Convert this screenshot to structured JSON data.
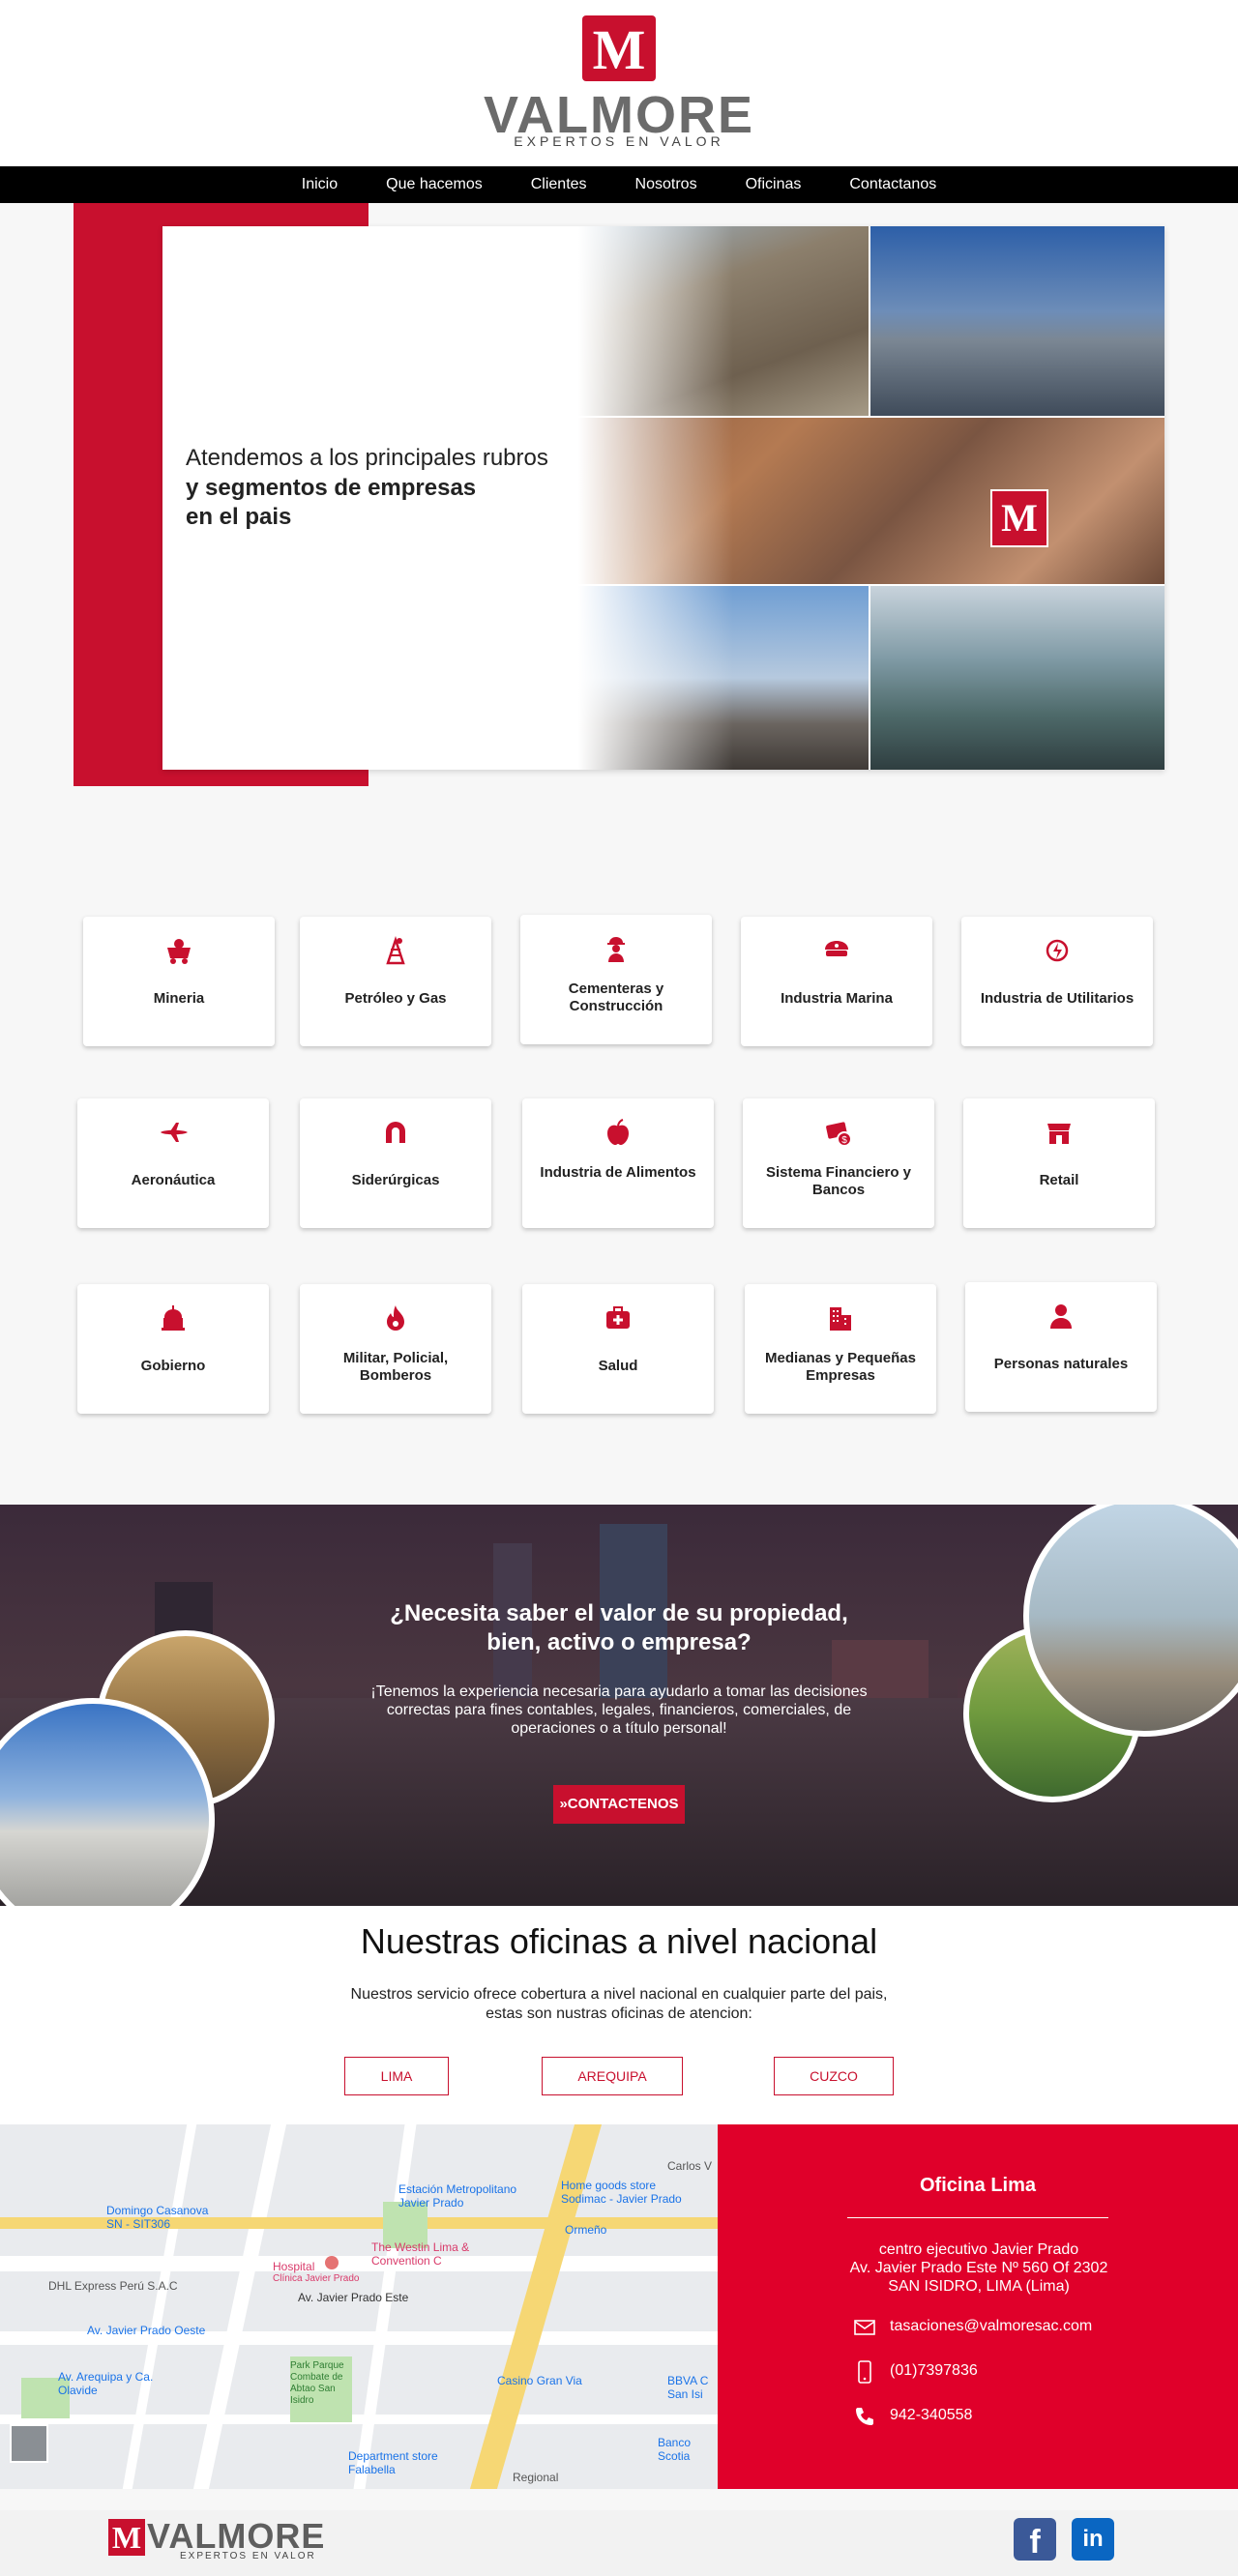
{
  "header": {
    "logo_letter": "M",
    "brand": "VALMORE",
    "tagline": "EXPERTOS EN VALOR"
  },
  "nav": {
    "items": [
      "Inicio",
      "Que hacemos",
      "Clientes",
      "Nosotros",
      "Oficinas",
      "Contactanos"
    ]
  },
  "hero": {
    "line1": "Atendemos a los principales rubros",
    "line2": "y segmentos de empresas",
    "line3": "en el pais",
    "badge_letter": "M"
  },
  "sectors": [
    {
      "label": "Mineria",
      "icon": "mining-cart-icon"
    },
    {
      "label": "Petróleo y Gas",
      "icon": "oil-derrick-icon"
    },
    {
      "label": "Cementeras y Construcción",
      "icon": "construction-worker-icon"
    },
    {
      "label": "Industria Marina",
      "icon": "captain-hat-icon"
    },
    {
      "label": "Industria de Utilitarios",
      "icon": "power-cycle-icon"
    },
    {
      "label": "Aeronáutica",
      "icon": "airplane-icon"
    },
    {
      "label": "Siderúrgicas",
      "icon": "magnet-icon"
    },
    {
      "label": "Industria de Alimentos",
      "icon": "apple-icon"
    },
    {
      "label": "Sistema Financiero y Bancos",
      "icon": "money-card-icon"
    },
    {
      "label": "Retail",
      "icon": "storefront-icon"
    },
    {
      "label": "Gobierno",
      "icon": "capitol-icon"
    },
    {
      "label": "Militar, Policial, Bomberos",
      "icon": "fire-icon"
    },
    {
      "label": "Salud",
      "icon": "medical-kit-icon"
    },
    {
      "label": "Medianas y Pequeñas Empresas",
      "icon": "office-building-icon"
    },
    {
      "label": "Personas naturales",
      "icon": "person-icon"
    }
  ],
  "cta": {
    "title_line1": "¿Necesita saber el valor de su propiedad,",
    "title_line2": "bien, activo o empresa?",
    "body": "¡Tenemos la experiencia necesaria para ayudarlo a tomar las decisiones correctas para fines contables, legales, financieros, comerciales, de operaciones o a título personal!",
    "button": "»CONTACTENOS"
  },
  "offices": {
    "title": "Nuestras oficinas a nivel nacional",
    "subtitle_line1": "Nuestros servicio ofrece cobertura a nivel nacional en cualquier parte del pais,",
    "subtitle_line2": "estas son nustras oficinas de atencion:",
    "buttons": [
      "LIMA",
      "AREQUIPA",
      "CUZCO"
    ]
  },
  "map": {
    "labels": [
      "Estación Metropolitano Javier Prado",
      "Home goods store Sodimac - Javier Prado",
      "Domingo Casanova SN - SIT306",
      "The Westin Lima & Convention C",
      "Hospital",
      "Clínica Javier Prado",
      "Av. Javier Prado Este",
      "Av. Javier Prado Oeste",
      "DHL Express Perú S.A.C",
      "Av. Arequipa y Ca. Olavide",
      "Park Parque Combate de Abtao San Isidro",
      "Casino Gran Via",
      "BBVA C San Isi",
      "Banco Scotia",
      "Department store Falabella",
      "Ormeño",
      "Regional",
      "Carlos V"
    ]
  },
  "office_info": {
    "title": "Oficina Lima",
    "address_line1": "centro ejecutivo Javier Prado",
    "address_line2": "Av. Javier Prado Este Nº 560 Of 2302",
    "address_line3": "SAN ISIDRO, LIMA (Lima)",
    "email": "tasaciones@valmoresac.com",
    "phone": "(01)7397836",
    "mobile": "942-340558"
  },
  "footer": {
    "logo_letter": "M",
    "brand": "VALMORE",
    "tagline": "EXPERTOS EN VALOR",
    "facebook": "f",
    "linkedin": "in"
  },
  "colors": {
    "brand_red": "#c8102e",
    "info_red": "#e0002a",
    "nav_black": "#000000",
    "facebook_blue": "#3b5998",
    "linkedin_blue": "#0a66c2"
  }
}
